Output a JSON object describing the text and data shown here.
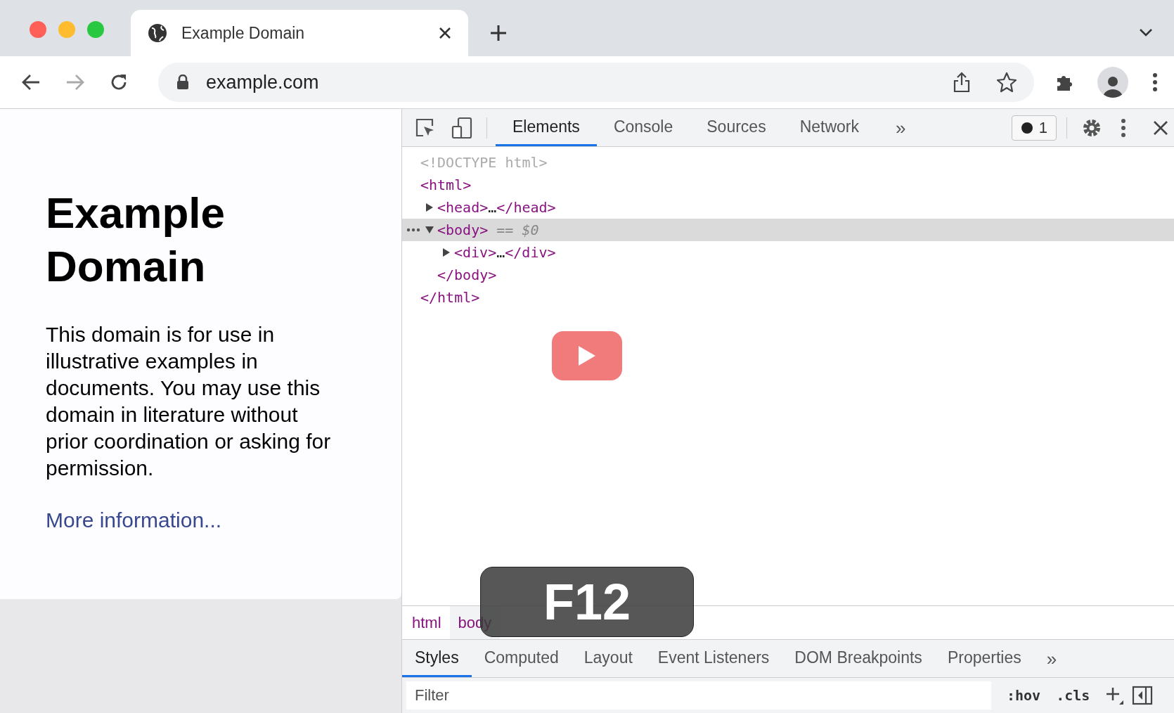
{
  "browser": {
    "tabs": [
      {
        "title": "Example Domain",
        "selected": true
      }
    ],
    "address": "example.com"
  },
  "page": {
    "heading": "Example Domain",
    "paragraph": "This domain is for use in illustrative examples in documents. You may use this domain in literature without prior coordination or asking for permission.",
    "link": "More information..."
  },
  "devtools": {
    "tabs": [
      {
        "label": "Elements",
        "selected": true
      },
      {
        "label": "Console",
        "selected": false
      },
      {
        "label": "Sources",
        "selected": false
      },
      {
        "label": "Network",
        "selected": false
      }
    ],
    "more_tabs": "»",
    "issues": "1",
    "dom": [
      {
        "kind": "doctype",
        "text": "<!DOCTYPE html>"
      },
      {
        "kind": "root",
        "open": "<html>",
        "close": "</html>",
        "children": [
          {
            "kind": "element",
            "open": "<head>",
            "ellipsis": "…",
            "close": "</head>",
            "expanded": false,
            "selected": false
          },
          {
            "kind": "element",
            "open": "<body>",
            "marker": "== *$0*",
            "close": "</body>",
            "expanded": true,
            "selected": true,
            "children": [
              {
                "kind": "element",
                "open": "<div>",
                "ellipsis": "…",
                "close": "</div>",
                "expanded": false,
                "selected": false
              }
            ]
          }
        ]
      }
    ],
    "breadcrumbs": [
      {
        "label": "html",
        "selected": false
      },
      {
        "label": "body",
        "selected": true
      }
    ],
    "pane_tabs": [
      {
        "label": "Styles",
        "selected": true
      },
      {
        "label": "Computed",
        "selected": false
      },
      {
        "label": "Layout",
        "selected": false
      },
      {
        "label": "Event Listeners",
        "selected": false
      },
      {
        "label": "DOM Breakpoints",
        "selected": false
      },
      {
        "label": "Properties",
        "selected": false
      }
    ],
    "pane_more_tabs": "»",
    "filter": {
      "placeholder": "Filter"
    },
    "hov": ":hov",
    "cls": ".cls"
  },
  "key_overlay": {
    "label": "F12"
  }
}
